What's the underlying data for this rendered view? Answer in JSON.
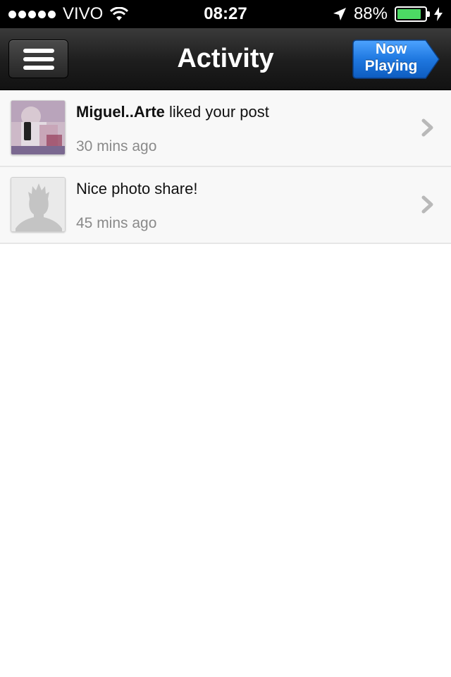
{
  "status_bar": {
    "carrier": "VIVO",
    "time": "08:27",
    "battery_percent": "88%",
    "battery_level": 0.88,
    "icons": [
      "signal-dots-icon",
      "wifi-icon",
      "location-arrow-icon",
      "battery-icon",
      "charging-bolt-icon"
    ]
  },
  "nav": {
    "title": "Activity",
    "menu_icon": "hamburger-menu-icon",
    "now_playing_line1": "Now",
    "now_playing_line2": "Playing",
    "now_playing_color": "#1a73d9"
  },
  "activity": {
    "items": [
      {
        "user": "Miguel..Arte",
        "message": " liked your post",
        "time": "30 mins ago",
        "avatar": "user-photo"
      },
      {
        "user": "",
        "message": "Nice photo share!",
        "time": "45 mins ago",
        "avatar": "default-silhouette"
      }
    ]
  }
}
